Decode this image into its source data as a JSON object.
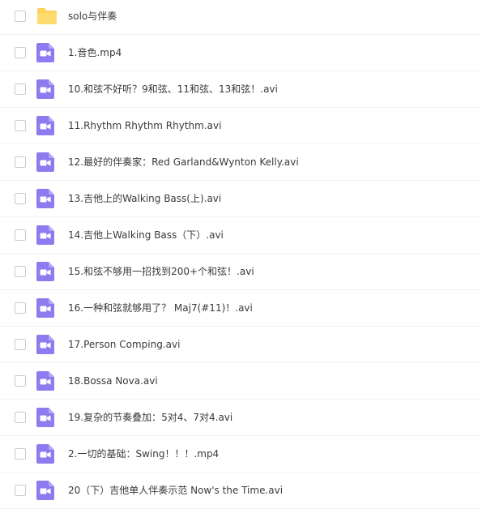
{
  "files": [
    {
      "name": "solo与伴奏",
      "type": "folder"
    },
    {
      "name": "1.音色.mp4",
      "type": "video"
    },
    {
      "name": "10.和弦不好听？9和弦、11和弦、13和弦！.avi",
      "type": "video"
    },
    {
      "name": "11.Rhythm Rhythm Rhythm.avi",
      "type": "video"
    },
    {
      "name": "12.最好的伴奏家：Red Garland&Wynton Kelly.avi",
      "type": "video"
    },
    {
      "name": "13.吉他上的Walking Bass(上).avi",
      "type": "video"
    },
    {
      "name": "14.吉他上Walking Bass（下）.avi",
      "type": "video"
    },
    {
      "name": "15.和弦不够用一招找到200+个和弦！.avi",
      "type": "video"
    },
    {
      "name": "16.一种和弦就够用了？ Maj7(#11)！.avi",
      "type": "video"
    },
    {
      "name": "17.Person Comping.avi",
      "type": "video"
    },
    {
      "name": "18.Bossa Nova.avi",
      "type": "video"
    },
    {
      "name": "19.复杂的节奏叠加：5对4、7对4.avi",
      "type": "video"
    },
    {
      "name": "2.一切的基础：Swing！！！.mp4",
      "type": "video"
    },
    {
      "name": "20（下）吉他单人伴奏示范 Now's the Time.avi",
      "type": "video"
    }
  ],
  "colors": {
    "folder": "#fdd35b",
    "video": "#8c7cf0",
    "row_divider": "#f0f2f5",
    "text": "#3a3a3a"
  },
  "icons": {
    "folder": "folder-icon",
    "video": "video-file-icon"
  }
}
